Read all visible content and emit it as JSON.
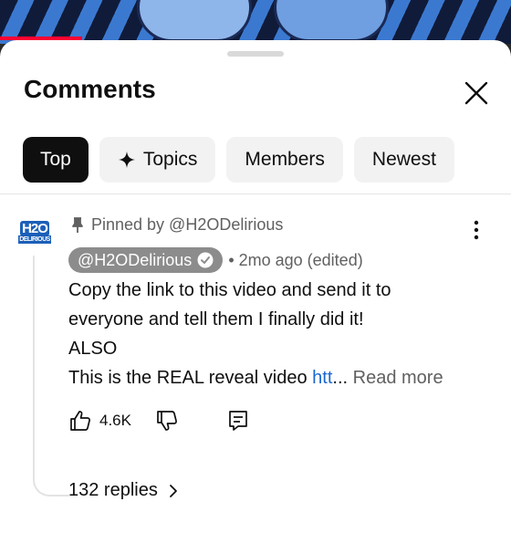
{
  "header": {
    "title": "Comments"
  },
  "chips": [
    {
      "label": "Top",
      "active": true
    },
    {
      "label": "Topics",
      "icon": "sparkle-icon"
    },
    {
      "label": "Members"
    },
    {
      "label": "Newest"
    }
  ],
  "comment": {
    "avatar_line1": "H2O",
    "avatar_line2": "DELIRIOUS",
    "pinned_text": "Pinned by @H2ODelirious",
    "author": "@H2ODelirious",
    "meta": "• 2mo ago (edited)",
    "lines": [
      "Copy the link to this video and send it to",
      "everyone and tell them I finally did it!",
      "ALSO"
    ],
    "last_line_text": "This is the REAL reveal video ",
    "link_text": "htt",
    "ellipsis": "...",
    "read_more": " Read more",
    "like_count": "4.6K",
    "replies_label": "132 replies"
  },
  "colors": {
    "accent_link": "#1a66d2",
    "chip_active": "#0f0f0f",
    "chip_bg": "#f2f2f2",
    "progress": "#ff0033"
  }
}
